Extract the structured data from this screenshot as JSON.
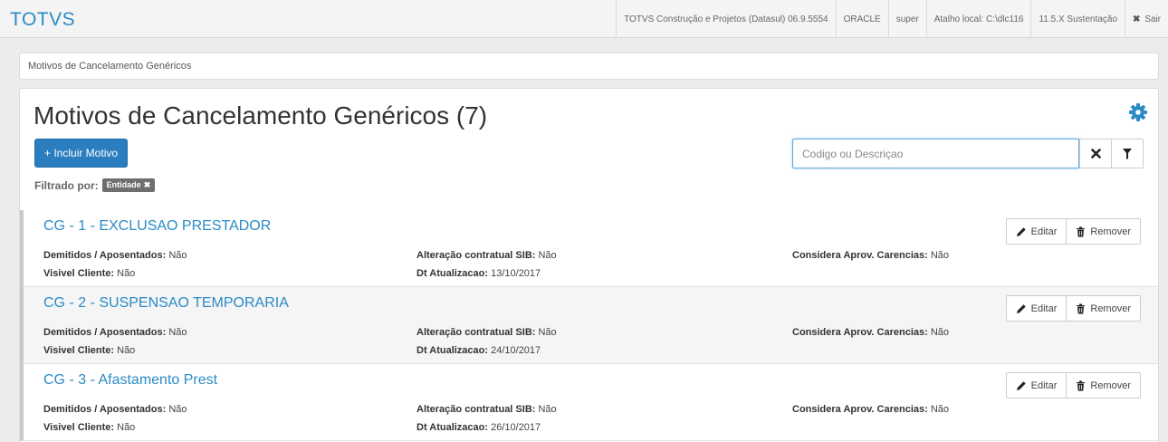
{
  "brand": "TOTVS",
  "topbar": {
    "items": [
      "TOTVS Construção e Projetos (Datasul) 06.9.5554",
      "ORACLE",
      "super",
      "Atalho local: C:\\dlc116",
      "11.5.X Sustentação"
    ],
    "logout_label": "Sair"
  },
  "breadcrumb": "Motivos de Cancelamento Genéricos",
  "page": {
    "title": "Motivos de Cancelamento Genéricos (7)",
    "add_button": "+ Incluir Motivo",
    "search_placeholder": "Codigo ou Descriçao",
    "filter_label": "Filtrado por:",
    "filter_tag": "Entidade"
  },
  "labels": {
    "demitidos": "Demitidos / Aposentados:",
    "alteracao": "Alteração contratual SIB:",
    "considera": "Considera Aprov. Carencias:",
    "visivel": "Visivel Cliente:",
    "dt": "Dt Atualizacao:",
    "edit": "Editar",
    "remove": "Remover"
  },
  "records": [
    {
      "title": "CG - 1 - EXCLUSAO PRESTADOR",
      "demitidos": "Não",
      "alteracao": "Não",
      "considera": "Não",
      "visivel": "Não",
      "dt": "13/10/2017"
    },
    {
      "title": "CG - 2 - SUSPENSAO TEMPORARIA",
      "demitidos": "Não",
      "alteracao": "Não",
      "considera": "Não",
      "visivel": "Não",
      "dt": "24/10/2017"
    },
    {
      "title": "CG - 3 - Afastamento Prest",
      "demitidos": "Não",
      "alteracao": "Não",
      "considera": "Não",
      "visivel": "Não",
      "dt": "26/10/2017"
    }
  ],
  "colors": {
    "brand": "#2a8bc6",
    "primary": "#2a7dbf"
  },
  "icons": {
    "gear": "gear-icon",
    "clear": "close-icon",
    "filter": "filter-icon",
    "edit": "pencil-icon",
    "remove": "trash-icon"
  }
}
